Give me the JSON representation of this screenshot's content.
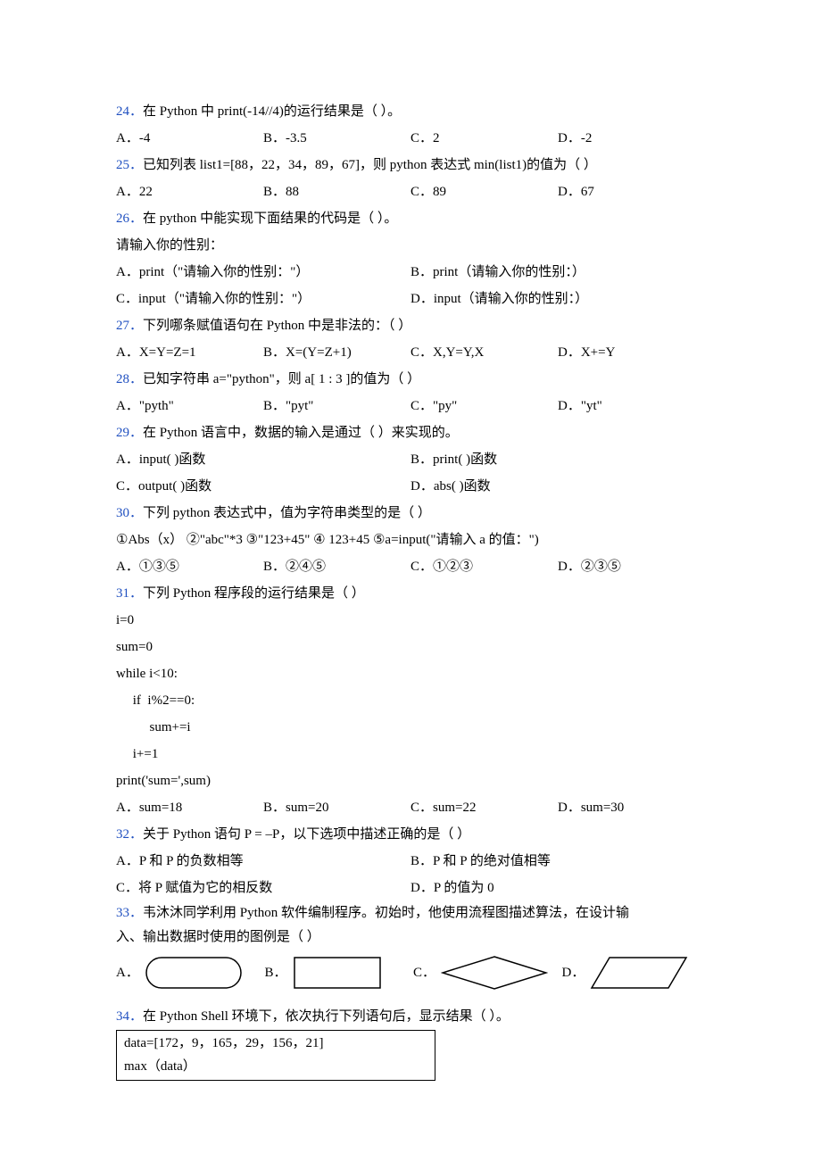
{
  "q24": {
    "num": "24．",
    "text": "在 Python 中 print(-14//4)的运行结果是（ ）。",
    "A": "A．-4",
    "B": "B．-3.5",
    "C": "C．2",
    "D": "D．-2"
  },
  "q25": {
    "num": "25．",
    "text": "已知列表 list1=[88，22，34，89，67]，则 python 表达式 min(list1)的值为（   ）",
    "A": "A．22",
    "B": "B．88",
    "C": "C．89",
    "D": "D．67"
  },
  "q26": {
    "num": "26．",
    "text": "在 python 中能实现下面结果的代码是（       ）。",
    "prompt": "请输入你的性别：",
    "A": "A．print（\"请输入你的性别：\"）",
    "B": "B．print（请输入你的性别：）",
    "C": "C．input（\"请输入你的性别：\"）",
    "D": "D．input（请输入你的性别：）"
  },
  "q27": {
    "num": "27．",
    "text": "下列哪条赋值语句在 Python 中是非法的：（     ）",
    "A": "A．X=Y=Z=1",
    "B": "B．X=(Y=Z+1)",
    "C": "C．X,Y=Y,X",
    "D": "D．X+=Y"
  },
  "q28": {
    "num": "28．",
    "text": "已知字符串 a=\"python\"，则 a[ 1 : 3 ]的值为（   ）",
    "A": "A．\"pyth\"",
    "B": "B．\"pyt\"",
    "C": "C．\"py\"",
    "D": "D．\"yt\""
  },
  "q29": {
    "num": "29．",
    "text": "在 Python 语言中，数据的输入是通过（       ）来实现的。",
    "A": "A．input( )函数",
    "B": "B．print( )函数",
    "C": "C．output( )函数",
    "D": "D．abs( )函数"
  },
  "q30": {
    "num": "30．",
    "text": "下列 python 表达式中，值为字符串类型的是（   ）",
    "items": "①Abs（x） ②\"abc\"*3   ③\"123+45\" ④ 123+45  ⑤a=input(\"请输入 a 的值：\")",
    "A": "A．①③⑤",
    "B": "B．②④⑤",
    "C": "C．①②③",
    "D": "D．②③⑤"
  },
  "q31": {
    "num": "31．",
    "text": "下列 Python 程序段的运行结果是（       ）",
    "code1": "i=0",
    "code2": "sum=0",
    "code3": "while i<10:",
    "code4": "     if  i%2==0:",
    "code5": "          sum+=i",
    "code6": "     i+=1",
    "code7": "print('sum=',sum)",
    "A": "A．sum=18",
    "B": "B．sum=20",
    "C": "C．sum=22",
    "D": "D．sum=30"
  },
  "q32": {
    "num": "32．",
    "text": "关于 Python 语句 P = –P，以下选项中描述正确的是（     ）",
    "A": "A．P 和 P 的负数相等",
    "B": "B．P 和 P 的绝对值相等",
    "C": "C．将 P 赋值为它的相反数",
    "D": "D．P 的值为 0"
  },
  "q33": {
    "num": "33．",
    "text1": "韦沐沐同学利用 Python 软件编制程序。初始时，他使用流程图描述算法，在设计输",
    "text2": "入、输出数据时使用的图例是（   ）",
    "A": "A．",
    "B": "B．",
    "C": "C．",
    "D": "D．"
  },
  "q34": {
    "num": "34．",
    "text": "在 Python Shell 环境下，依次执行下列语句后，显示结果（   ）。",
    "code1": "data=[172，9，165，29，156，21]",
    "code2": "max（data）"
  }
}
